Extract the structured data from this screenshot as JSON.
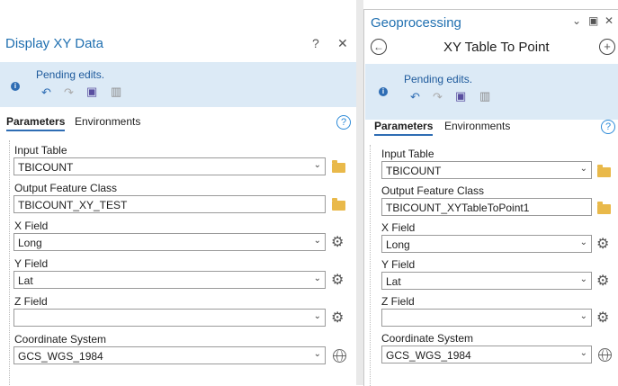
{
  "left": {
    "title": "Display XY Data",
    "help_label": "?",
    "close_label": "✕",
    "pending_text": "Pending edits.",
    "tabs": [
      "Parameters",
      "Environments"
    ],
    "fields": [
      {
        "label": "Input Table",
        "value": "TBICOUNT",
        "type": "dropdown",
        "side": "folder"
      },
      {
        "label": "Output Feature Class",
        "value": "TBICOUNT_XY_TEST",
        "type": "text",
        "side": "folder"
      },
      {
        "label": "X Field",
        "value": "Long",
        "type": "dropdown",
        "side": "gear"
      },
      {
        "label": "Y Field",
        "value": "Lat",
        "type": "dropdown",
        "side": "gear"
      },
      {
        "label": "Z Field",
        "value": "",
        "type": "dropdown",
        "side": "gear"
      },
      {
        "label": "Coordinate System",
        "value": "GCS_WGS_1984",
        "type": "dropdown",
        "side": "globe"
      }
    ]
  },
  "right": {
    "title": "Geoprocessing",
    "tool_title": "XY Table To Point",
    "pending_text": "Pending edits.",
    "tabs": [
      "Parameters",
      "Environments"
    ],
    "fields": [
      {
        "label": "Input Table",
        "value": "TBICOUNT",
        "type": "dropdown",
        "side": "folder"
      },
      {
        "label": "Output Feature Class",
        "value": "TBICOUNT_XYTableToPoint1",
        "type": "text",
        "side": "folder"
      },
      {
        "label": "X Field",
        "value": "Long",
        "type": "dropdown",
        "side": "gear"
      },
      {
        "label": "Y Field",
        "value": "Lat",
        "type": "dropdown",
        "side": "gear"
      },
      {
        "label": "Z Field",
        "value": "",
        "type": "dropdown",
        "side": "gear"
      },
      {
        "label": "Coordinate System",
        "value": "GCS_WGS_1984",
        "type": "dropdown",
        "side": "globe"
      }
    ]
  },
  "colors": {
    "accent": "#1f6fb0",
    "pending_bg": "#dceaf6",
    "folder": "#e9b94a"
  }
}
